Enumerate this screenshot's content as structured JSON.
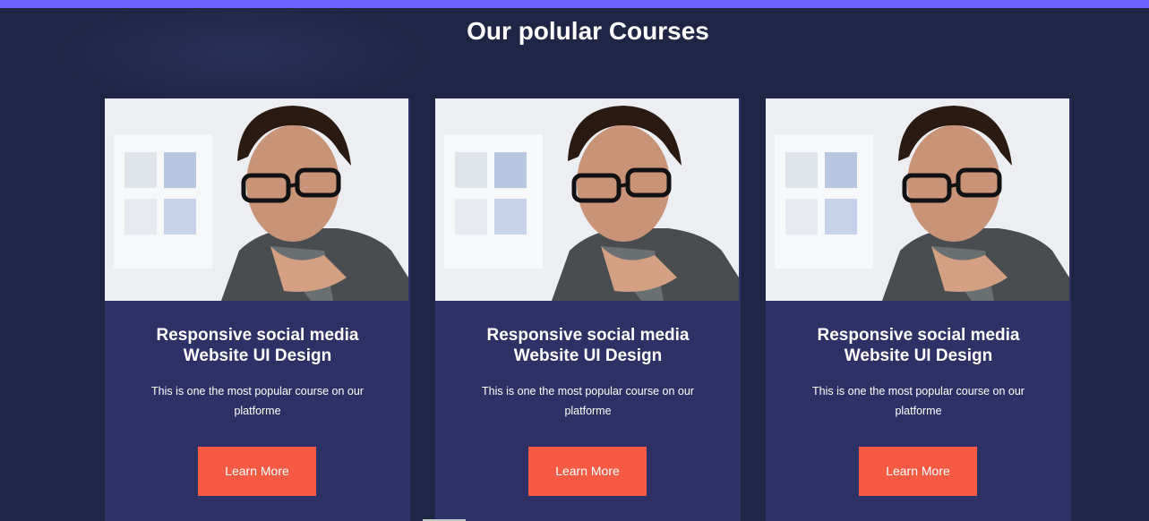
{
  "header": {
    "title": "Our polular Courses"
  },
  "colors": {
    "background": "#1f2544",
    "top_bar": "#6c63ff",
    "card_background": "#2e3165",
    "button_background": "#f65a42",
    "text": "#ffffff"
  },
  "courses": [
    {
      "image": "portrait-photo",
      "title_line1": "Responsive social media",
      "title_line2": "Website UI Design",
      "description_line1": "This is one the most popular course on our",
      "description_line2": "platforme",
      "button_label": "Learn More"
    },
    {
      "image": "portrait-photo",
      "title_line1": "Responsive social media",
      "title_line2": "Website UI Design",
      "description_line1": "This is one the most popular course on our",
      "description_line2": "platforme",
      "button_label": "Learn More"
    },
    {
      "image": "portrait-photo",
      "title_line1": "Responsive social media",
      "title_line2": "Website UI Design",
      "description_line1": "This is one the most popular course on our",
      "description_line2": "platforme",
      "button_label": "Learn More"
    }
  ]
}
